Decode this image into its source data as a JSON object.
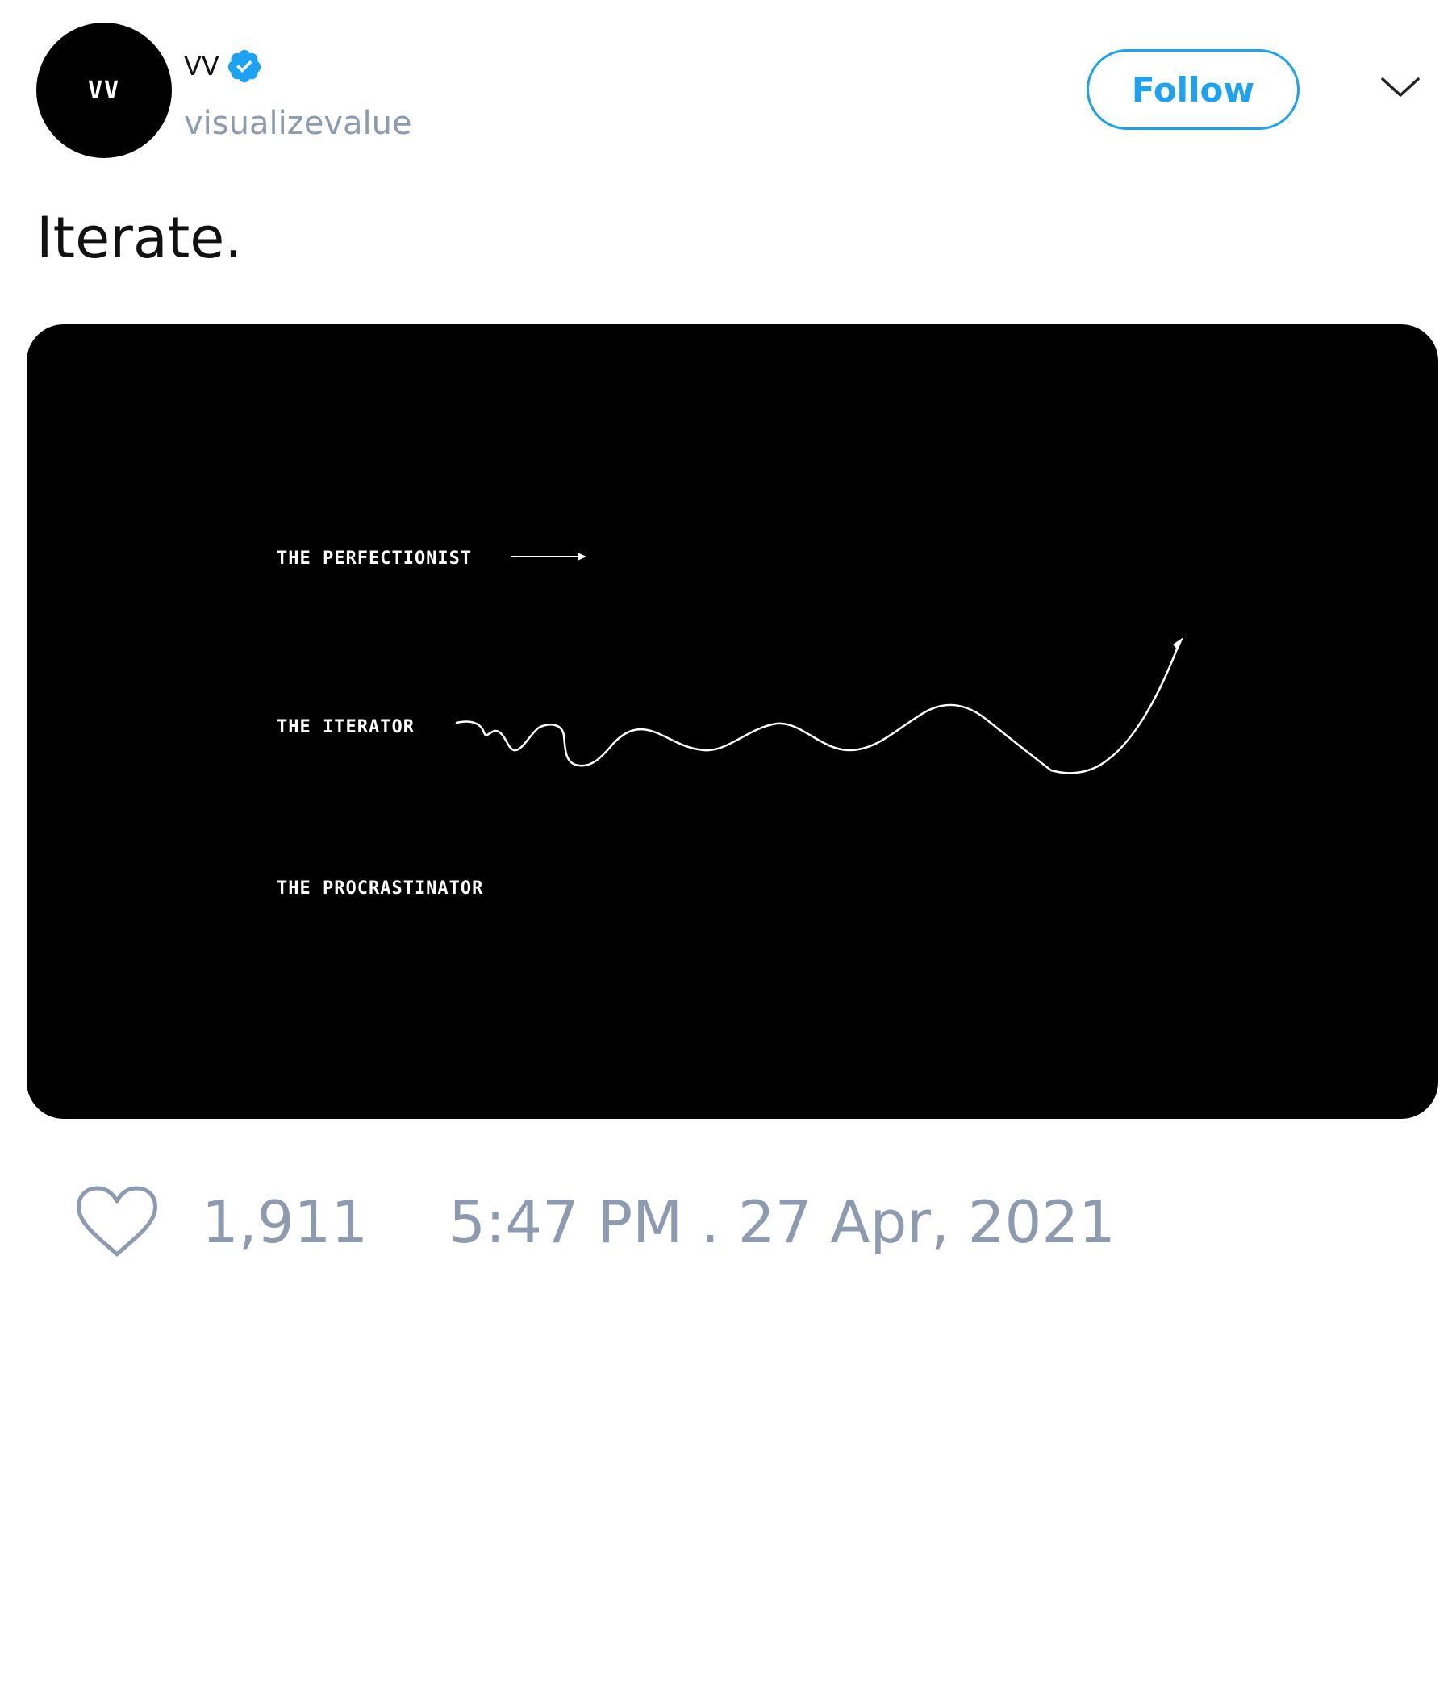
{
  "author": {
    "display_name": "VV",
    "handle": "visualizevalue",
    "avatar_text": "VV",
    "verified": true
  },
  "follow_button": {
    "label": "Follow"
  },
  "tweet": {
    "text": "Iterate."
  },
  "media": {
    "labels": {
      "perfectionist": "THE PERFECTIONIST",
      "iterator": "THE ITERATOR",
      "procrastinator": "THE PROCRASTINATOR"
    }
  },
  "actions": {
    "like_count": "1,911",
    "timestamp": "5:47 PM . 27 Apr, 2021"
  },
  "icons": {
    "avatar": "vv-logo",
    "verified": "verified-badge-icon",
    "menu": "chevron-down-icon",
    "like": "heart-icon"
  },
  "colors": {
    "accent": "#1da1f2",
    "muted_text": "#8d9bb0",
    "text": "#111111",
    "media_background": "#000000"
  }
}
